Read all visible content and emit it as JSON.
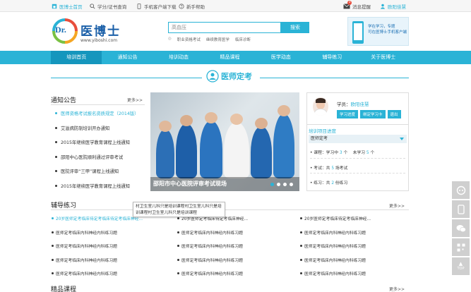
{
  "topbar": {
    "home": "医博士首页",
    "query": "学分/证书查询",
    "app_download": "手机客户端下载",
    "help": "新手帮助",
    "messages": "消息提醒",
    "message_count": "3",
    "user": "欧阳佳慧"
  },
  "logo": {
    "brand_en": "Dr.",
    "brand_cn": "医博士",
    "url": "www.yiboshi.com"
  },
  "search": {
    "value": "高血压",
    "button": "搜索",
    "hot": [
      "职业资格考试",
      "继续教育医学",
      "临床诊断"
    ]
  },
  "app_promo": {
    "line1": "学在学习，专题",
    "line2": "可在医博士手机客户端"
  },
  "nav": {
    "items": [
      "培训首页",
      "通知公告",
      "培训动态",
      "精品课程",
      "医学动态",
      "辅导练习",
      "关于医博士"
    ],
    "active": 0
  },
  "section": {
    "title": "医师定考"
  },
  "notice": {
    "title": "通知公告",
    "more": "更多>>",
    "items": [
      "医师资格考试报名资质规定（2014版）",
      "艾滋病防制培训开办通知",
      "2015年继续医学教育课程上线通知",
      "邵阳中心医院顺利通过评审考试",
      "医院评审“三甲”课程上线通知",
      "2015年继续医学教育课程上线通知"
    ]
  },
  "banner": {
    "caption": "邵阳市中心医院评审考试现场",
    "dots": 4,
    "active_dot": 0
  },
  "student": {
    "label": "学员：",
    "name": "欧阳佳慧",
    "buttons": [
      "学习进度",
      "绑定学习卡",
      "退出"
    ],
    "progress_title": "培训项目进度",
    "select_value": "医师定考",
    "stats": {
      "course_label": "课程：",
      "course_learning": "学习中",
      "course_learning_n": "3",
      "course_learning_unit": "个",
      "course_not": "未学习",
      "course_not_n": "5",
      "course_not_unit": "个",
      "exam_label": "考试：",
      "exam_total": "共",
      "exam_n": "5",
      "exam_unit": "场考试",
      "practice_label": "练习：",
      "practice_total": "共",
      "practice_n": "2",
      "practice_unit": "份练习"
    }
  },
  "exercise": {
    "title": "辅导练习",
    "more": "更多>>",
    "items": [
      "20岁医师定考临床待定考临床待定考临床神经...",
      "20岁医师定考临床待定考临床神经...",
      "20岁医师定考临床待定考临床神经...",
      "医师定考临床内科神经内科练习题",
      "医师定考临床内科神经内科练习题",
      "医师定考临床内科神经内科练习题",
      "医师定考临床内科神经内科练习题",
      "医师定考临床内科神经内科练习题",
      "医师定考临床内科神经内科练习题",
      "医师定考临床内科神经内科练习题",
      "医师定考临床内科神经内科练习题",
      "医师定考临床内科神经内科练习题",
      "医师定考临床内科神经内科练习题",
      "医师定考临床内科神经内科练习题",
      "医师定考临床内科神经内科练习题"
    ],
    "tooltip": "村卫生室儿科只是培训课程村卫生室儿科只是培训课程村卫生室儿科只是培训课程"
  },
  "courses": {
    "title": "精品课程",
    "more": "更多>>"
  },
  "side": {
    "top_label": "TOP"
  },
  "colors": {
    "accent": "#2ab3d6",
    "accent_dark": "#1596bd"
  }
}
